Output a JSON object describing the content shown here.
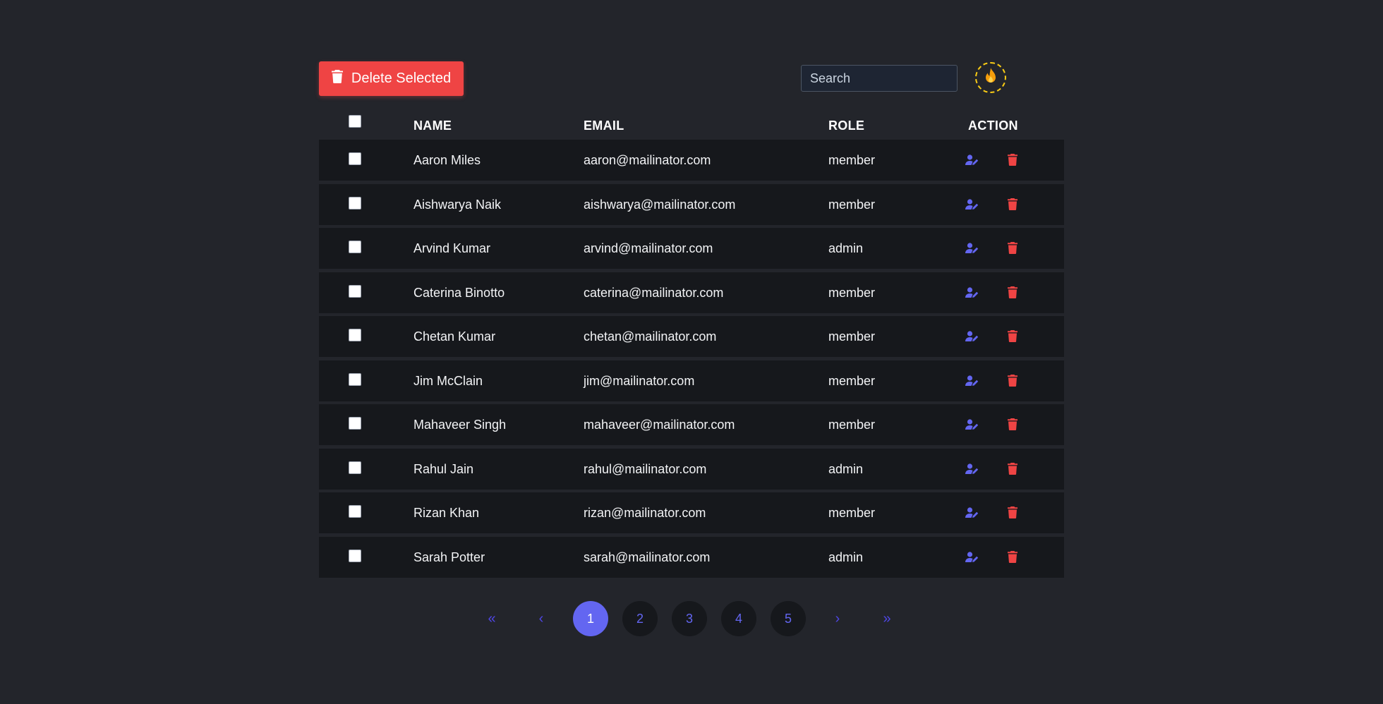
{
  "toolbar": {
    "delete_selected_label": "Delete Selected",
    "search_placeholder": "Search",
    "search_value": "",
    "theme_icon": "flame-icon"
  },
  "table": {
    "columns": [
      "NAME",
      "EMAIL",
      "ROLE",
      "ACTION"
    ],
    "rows": [
      {
        "name": "Aaron Miles",
        "email": "aaron@mailinator.com",
        "role": "member"
      },
      {
        "name": "Aishwarya Naik",
        "email": "aishwarya@mailinator.com",
        "role": "member"
      },
      {
        "name": "Arvind Kumar",
        "email": "arvind@mailinator.com",
        "role": "admin"
      },
      {
        "name": "Caterina Binotto",
        "email": "caterina@mailinator.com",
        "role": "member"
      },
      {
        "name": "Chetan Kumar",
        "email": "chetan@mailinator.com",
        "role": "member"
      },
      {
        "name": "Jim McClain",
        "email": "jim@mailinator.com",
        "role": "member"
      },
      {
        "name": "Mahaveer Singh",
        "email": "mahaveer@mailinator.com",
        "role": "member"
      },
      {
        "name": "Rahul Jain",
        "email": "rahul@mailinator.com",
        "role": "admin"
      },
      {
        "name": "Rizan Khan",
        "email": "rizan@mailinator.com",
        "role": "member"
      },
      {
        "name": "Sarah Potter",
        "email": "sarah@mailinator.com",
        "role": "admin"
      }
    ],
    "row_actions": [
      "edit-user-icon",
      "trash-icon"
    ]
  },
  "pagination": {
    "first": "«",
    "prev": "‹",
    "pages": [
      "1",
      "2",
      "3",
      "4",
      "5"
    ],
    "current_page": "1",
    "next": "›",
    "last": "»"
  },
  "colors": {
    "background": "#23252b",
    "row_background": "#16181c",
    "danger": "#ef4444",
    "accent": "#6366f1",
    "theme_ring": "#facc15"
  }
}
